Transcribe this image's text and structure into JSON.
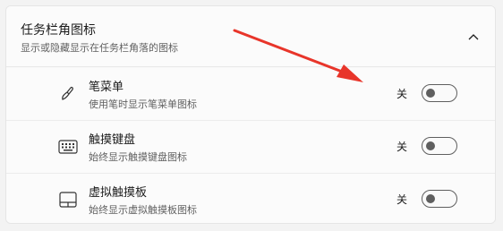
{
  "section": {
    "title": "任务栏角图标",
    "subtitle": "显示或隐藏显示在任务栏角落的图标",
    "collapse_icon": "chevron-up-icon"
  },
  "rows": [
    {
      "icon": "pen-icon",
      "title": "笔菜单",
      "desc": "使用笔时显示笔菜单图标",
      "state_label": "关",
      "on": false
    },
    {
      "icon": "keyboard-icon",
      "title": "触摸键盘",
      "desc": "始终显示触摸键盘图标",
      "state_label": "关",
      "on": false
    },
    {
      "icon": "touchpad-icon",
      "title": "虚拟触摸板",
      "desc": "始终显示虚拟触摸板图标",
      "state_label": "关",
      "on": false
    }
  ],
  "colors": {
    "annotation_arrow": "#e8352a",
    "toggle_off": "#5f5f5f"
  }
}
